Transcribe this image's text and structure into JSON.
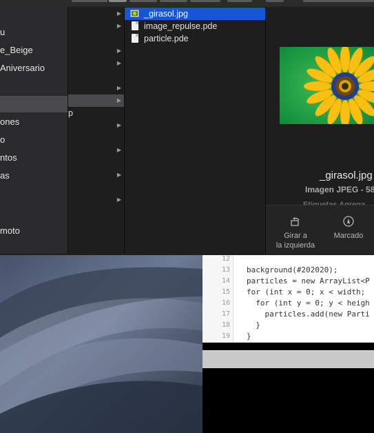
{
  "sidebar": {
    "items": [
      {
        "label": "u"
      },
      {
        "label": "e_Beige"
      },
      {
        "label": "Aniversario"
      },
      {
        "label": ""
      },
      {
        "label": "ones"
      },
      {
        "label": "o"
      },
      {
        "label": "ntos"
      },
      {
        "label": "as"
      },
      {
        "label": ""
      },
      {
        "label": "moto"
      }
    ]
  },
  "column2": {
    "rows": [
      {
        "label": "p"
      }
    ]
  },
  "column3": {
    "files": [
      {
        "name": "_girasol.jpg",
        "kind": "image",
        "selected": true
      },
      {
        "name": "image_repulse.pde",
        "kind": "document",
        "selected": false
      },
      {
        "name": "particle.pde",
        "kind": "document",
        "selected": false
      }
    ]
  },
  "preview": {
    "file_name": "_girasol.jpg",
    "kind_label": "Imagen JPEG - 58",
    "tags_label": "Etiquetas   Agrega",
    "actions": [
      {
        "label_line1": "Girar a",
        "label_line2": "la izquierda",
        "icon": "rotate-left-icon"
      },
      {
        "label_line1": "Marcado",
        "label_line2": "",
        "icon": "markup-icon"
      }
    ]
  },
  "editor": {
    "lines": [
      {
        "num": "12",
        "text": ""
      },
      {
        "num": "13",
        "text": "background(#202020);"
      },
      {
        "num": "14",
        "text": "particles = new ArrayList<P"
      },
      {
        "num": "15",
        "text": "for (int x = 0; x < width;"
      },
      {
        "num": "16",
        "text": "  for (int y = 0; y < heigh"
      },
      {
        "num": "17",
        "text": "    particles.add(new Parti"
      },
      {
        "num": "18",
        "text": "  }"
      },
      {
        "num": "19",
        "text": "}"
      }
    ]
  },
  "colors": {
    "selection_blue": "#1456d6",
    "selection_gray": "#4a4a4c",
    "sidebar_bg": "#2a2a2c"
  }
}
